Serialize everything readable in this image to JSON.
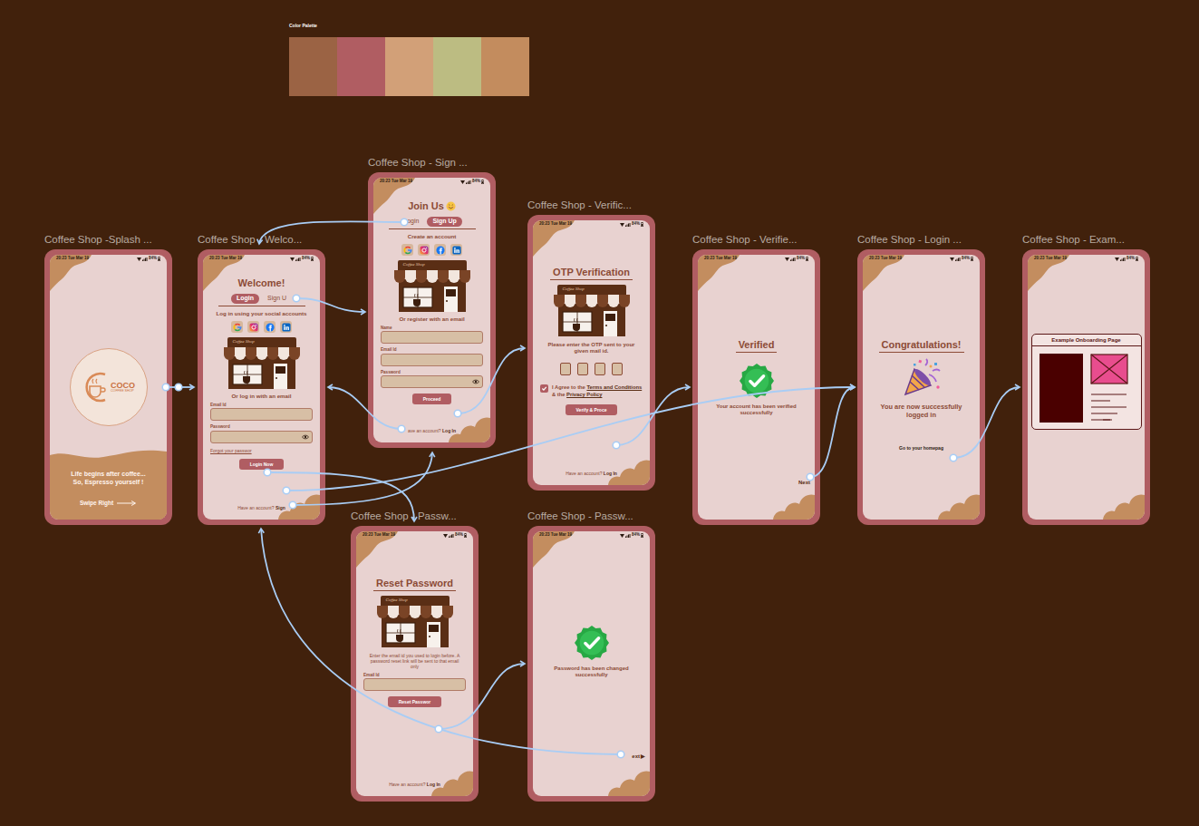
{
  "palette": {
    "title": "Color Palette",
    "swatches": [
      {
        "color": "#9b6344"
      },
      {
        "color": "#b05d62"
      },
      {
        "color": "#d2a078"
      },
      {
        "color": "#bcbc82"
      },
      {
        "color": "#c38c5e"
      }
    ]
  },
  "status_bar": {
    "time": "20:23 Tue Mar 19",
    "battery": "84%"
  },
  "shop_sign": "Coffee Shop",
  "frames": [
    {
      "title": "Coffee Shop -Splash ...",
      "kind": "splash",
      "logo_name": "COCO",
      "logo_sub": "COFFEE SHOP",
      "lines": [
        "Life begins after coffee...",
        "So, Espresso yourself !"
      ],
      "cta": "Swipe Right"
    },
    {
      "title": "Coffee Shop - Welco...",
      "kind": "login-form",
      "heading": "Welcome!",
      "tabs": [
        {
          "label": "Login",
          "selected": true
        },
        {
          "label": "Sign U",
          "selected": false
        }
      ],
      "subtitle": "Log in using your social accounts",
      "divider": "Or log in with an email",
      "fields": [
        {
          "label": "Email Id",
          "kind": "text"
        },
        {
          "label": "Password",
          "kind": "password"
        }
      ],
      "link": "Forgot your passwor",
      "button": "Login Now",
      "footer_text": "Have an account? ",
      "footer_link": "Sign"
    },
    {
      "title": "Coffee Shop -  Sign ...",
      "kind": "signup-form",
      "heading": "Join Us",
      "tabs": [
        {
          "label": "ogin",
          "selected": false
        },
        {
          "label": "Sign Up",
          "selected": true
        }
      ],
      "subtitle": "Create an account",
      "divider": "Or register with an email",
      "fields": [
        {
          "label": "Name",
          "kind": "text"
        },
        {
          "label": "Email Id",
          "kind": "text"
        },
        {
          "label": "Password",
          "kind": "password"
        }
      ],
      "button": "Proceed",
      "footer_text": "ave an account? ",
      "footer_link": "Log In"
    },
    {
      "title": "Coffee Shop - Verific...",
      "kind": "otp",
      "heading": "OTP Verification",
      "text": "Please enter the OTP sent to your given mail id.",
      "otp": [
        "",
        "",
        "",
        ""
      ],
      "agree": {
        "checked": true,
        "parts": [
          {
            "text": "I Agree to the ",
            "kind": "plain"
          },
          {
            "text": "Terms and Conditions",
            "kind": "link"
          },
          {
            "text": " & the ",
            "kind": "plain"
          },
          {
            "text": "Privacy Policy",
            "kind": "link"
          }
        ]
      },
      "button": "Verify & Proce",
      "footer_text": "Have an account? ",
      "footer_link": "Log In"
    },
    {
      "title": "Coffee Shop - Verifie...",
      "kind": "verified",
      "heading": "Verified",
      "text": "Your account has been verified successfully",
      "next": "Next"
    },
    {
      "title": "Coffee Shop - Login ...",
      "kind": "congrats",
      "heading": "Congratulations!",
      "text": "You are now successfully logged in",
      "link": "Go to your homepag"
    },
    {
      "title": "Coffee Shop -  Exam...",
      "kind": "example",
      "heading": "Example Onboarding Page"
    },
    {
      "title": "Coffee Shop - Passw...",
      "kind": "reset",
      "heading": "Reset Password",
      "text": "Enter the email id you used to login before. A password reset link will be sent to that email only",
      "fields": [
        {
          "label": "Email Id",
          "kind": "text"
        }
      ],
      "button": "Reset Passwor",
      "footer_text": "Have an account? ",
      "footer_link": "Log In"
    },
    {
      "title": "Coffee Shop - Passw...",
      "kind": "changed",
      "text": "Password has been changed successfully",
      "next": "ext",
      "next_icon": "▶"
    }
  ]
}
